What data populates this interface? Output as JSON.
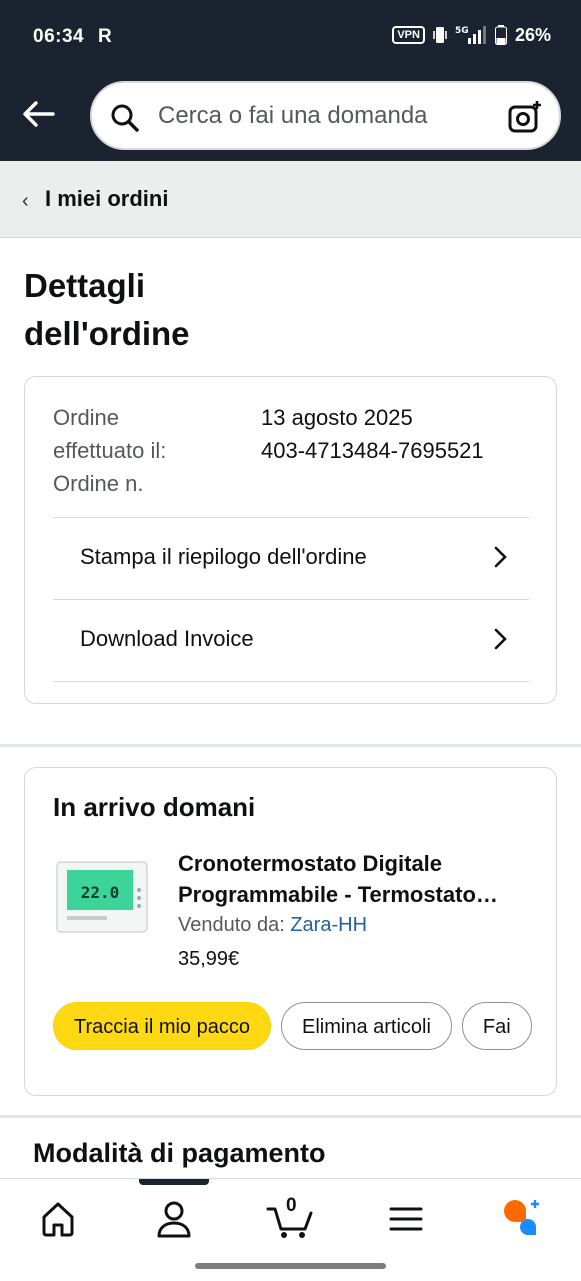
{
  "status_bar": {
    "time": "06:34",
    "carrier_logo": "R",
    "vpn": "VPN",
    "battery": "26%"
  },
  "search": {
    "placeholder": "Cerca o fai una domanda"
  },
  "breadcrumb": {
    "label": "I miei ordini"
  },
  "page": {
    "title_line1": "Dettagli",
    "title_line2": "dell'ordine"
  },
  "order_info": {
    "label_date_1": "Ordine",
    "label_date_2": "effettuato il:",
    "label_number": "Ordine n.",
    "date": "13 agosto 2025",
    "number": "403-4713484-7695521",
    "actions": [
      {
        "label": "Stampa il riepilogo dell'ordine"
      },
      {
        "label": "Download Invoice"
      }
    ]
  },
  "shipment": {
    "status": "In arrivo domani",
    "product_line1": "Cronotermostato Digitale",
    "product_line2": "Programmabile - Termostato…",
    "sold_by_label": "Venduto da:",
    "seller": "Zara-HH",
    "price": "35,99€",
    "thumb_display": "22.0",
    "buttons": [
      {
        "label": "Traccia il mio pacco"
      },
      {
        "label": "Elimina articoli"
      },
      {
        "label": "Fai"
      }
    ]
  },
  "payment": {
    "title": "Modalità di pagamento"
  },
  "bottom_nav": {
    "cart_count": "0",
    "icons": [
      "home-icon",
      "account-icon",
      "cart-icon",
      "menu-icon",
      "rufus-icon"
    ]
  },
  "colors": {
    "header": "#1b2330",
    "accent_yellow": "#ffd814",
    "link": "#2162a1",
    "rufus_orange": "#ff6a00",
    "rufus_blue": "#1a8cff"
  }
}
